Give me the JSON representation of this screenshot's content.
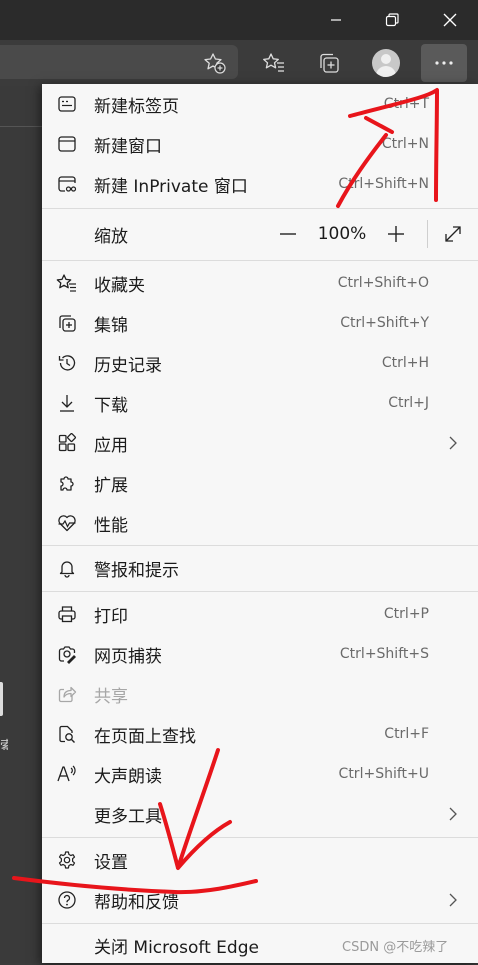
{
  "window_controls": {
    "minimize_icon": "minimize-icon",
    "restore_icon": "restore-icon",
    "close_icon": "close-icon"
  },
  "toolbar": {
    "favorite_add_icon": "favorite-add-icon",
    "favorites_icon": "favorites-icon",
    "collections_icon": "collections-icon",
    "profile_icon": "profile-avatar",
    "more_icon": "more-icon"
  },
  "menu": {
    "new_tab": {
      "label": "新建标签页",
      "shortcut": "Ctrl+T"
    },
    "new_window": {
      "label": "新建窗口",
      "shortcut": "Ctrl+N"
    },
    "new_inprivate": {
      "label": "新建 InPrivate 窗口",
      "shortcut": "Ctrl+Shift+N"
    },
    "zoom": {
      "label": "缩放",
      "minus": "—",
      "value": "100%",
      "plus": "+"
    },
    "favorites": {
      "label": "收藏夹",
      "shortcut": "Ctrl+Shift+O"
    },
    "collections": {
      "label": "集锦",
      "shortcut": "Ctrl+Shift+Y"
    },
    "history": {
      "label": "历史记录",
      "shortcut": "Ctrl+H"
    },
    "downloads": {
      "label": "下载",
      "shortcut": "Ctrl+J"
    },
    "apps": {
      "label": "应用"
    },
    "extensions": {
      "label": "扩展"
    },
    "performance": {
      "label": "性能"
    },
    "alerts": {
      "label": "警报和提示"
    },
    "print": {
      "label": "打印",
      "shortcut": "Ctrl+P"
    },
    "web_capture": {
      "label": "网页捕获",
      "shortcut": "Ctrl+Shift+S"
    },
    "share": {
      "label": "共享"
    },
    "find": {
      "label": "在页面上查找",
      "shortcut": "Ctrl+F"
    },
    "read_aloud": {
      "label": "大声朗读",
      "shortcut": "Ctrl+Shift+U"
    },
    "more_tools": {
      "label": "更多工具"
    },
    "settings": {
      "label": "设置"
    },
    "help": {
      "label": "帮助和反馈"
    },
    "close_edge": {
      "label": "关闭 Microsoft Edge"
    }
  },
  "page_fragment": {
    "glyph": "索"
  },
  "watermark": "CSDN @不吃辣了",
  "colors": {
    "menu_bg": "#f7f7f7",
    "chrome_bg": "#3b3b3b",
    "annotation_red": "#e8151b"
  }
}
